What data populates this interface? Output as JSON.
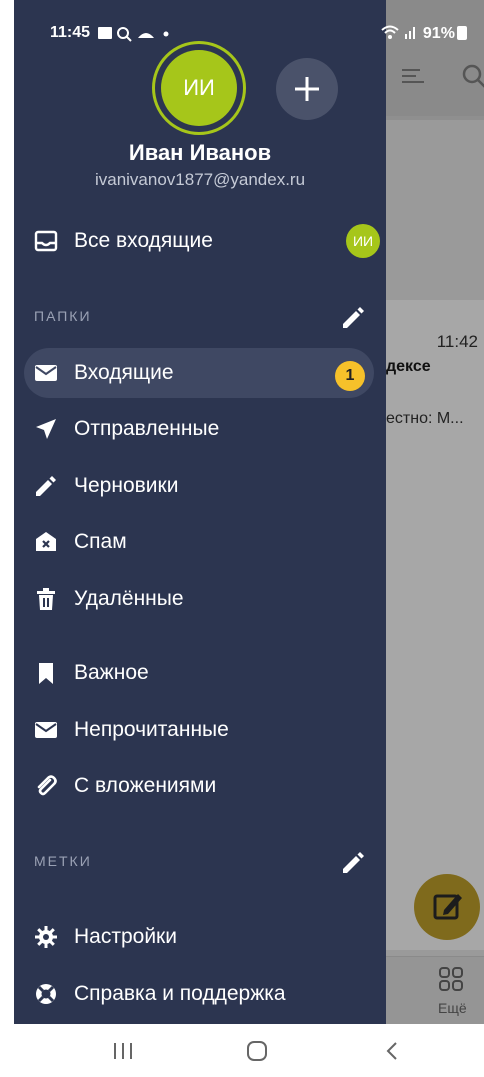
{
  "status_bar": {
    "time": "11:45",
    "battery": "91%"
  },
  "account": {
    "avatar_initials": "ИИ",
    "name": "Иван Иванов",
    "email": "ivanivanov1877@yandex.ru"
  },
  "all_inbox": {
    "label": "Все входящие",
    "avatar_initials": "ИИ"
  },
  "sections": {
    "folders_title": "ПАПКИ",
    "labels_title": "МЕТКИ"
  },
  "folders": [
    {
      "label": "Входящие",
      "icon": "envelope-icon",
      "badge": "1",
      "active": true
    },
    {
      "label": "Отправленные",
      "icon": "send-icon"
    },
    {
      "label": "Черновики",
      "icon": "pencil-icon"
    },
    {
      "label": "Спам",
      "icon": "spam-icon"
    },
    {
      "label": "Удалённые",
      "icon": "trash-icon"
    }
  ],
  "filters": [
    {
      "label": "Важное",
      "icon": "bookmark-icon"
    },
    {
      "label": "Непрочитанные",
      "icon": "envelope-icon"
    },
    {
      "label": "С вложениями",
      "icon": "paperclip-icon"
    }
  ],
  "bottom": [
    {
      "label": "Настройки",
      "icon": "gear-icon"
    },
    {
      "label": "Справка и поддержка",
      "icon": "lifebuoy-icon"
    }
  ],
  "background_app": {
    "time": "11:42",
    "subject_fragment": "дексе",
    "preview_fragment": "естно: М...",
    "more_label": "Ещё"
  },
  "colors": {
    "drawer_bg": "#2c3550",
    "active_item_bg": "#3f4863",
    "avatar_green": "#a6c61a",
    "badge_yellow": "#f6c12a"
  }
}
